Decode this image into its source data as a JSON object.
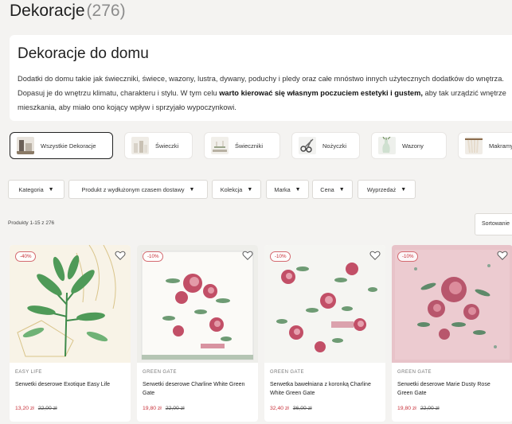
{
  "header": {
    "title": "Dekoracje",
    "count": "(276)"
  },
  "intro": {
    "heading": "Dekoracje do domu",
    "text_before": "Dodatki do domu takie jak świeczniki, świece, wazony, lustra, dywany, poduchy i pledy oraz całe mnóstwo innych użytecznych dodatków do wnętrza. Dopasuj je do wnętrzu klimatu, charakteru i stylu. W tym celu ",
    "text_bold": "warto kierować się własnym poczuciem estetyki i gustem,",
    "text_after": " aby tak urządzić wnętrze mieszkania, aby miało ono kojący wpływ i sprzyjało wypoczynkowi."
  },
  "categories": [
    {
      "label": "Wszystkie Dekoracje",
      "active": true,
      "icon": "decor-thumb"
    },
    {
      "label": "Świeczki",
      "active": false,
      "icon": "candles-thumb"
    },
    {
      "label": "Świeczniki",
      "active": false,
      "icon": "candlesticks-thumb"
    },
    {
      "label": "Nożyczki",
      "active": false,
      "icon": "scissors-thumb"
    },
    {
      "label": "Wazony",
      "active": false,
      "icon": "vase-thumb"
    },
    {
      "label": "Makramy",
      "active": false,
      "icon": "macrame-thumb"
    }
  ],
  "filters": [
    {
      "label": "Kategoria"
    },
    {
      "label": "Produkt z wydłużonym czasem dostawy"
    },
    {
      "label": "Kolekcja"
    },
    {
      "label": "Marka"
    },
    {
      "label": "Cena"
    },
    {
      "label": "Wyprzedaż"
    }
  ],
  "listing": {
    "count_label": "Produkty 1-15 z 276",
    "sort_label": "Sortowanie"
  },
  "products": [
    {
      "badge": "-40%",
      "brand": "EASY LIFE",
      "name": "Serwetki deserowe Exotique Easy Life",
      "price": "13,20 zł",
      "old_price": "22,00 zł"
    },
    {
      "badge": "-10%",
      "brand": "GREEN GATE",
      "name": "Serwetki deserowe Charline White Green Gate",
      "price": "19,80 zł",
      "old_price": "22,00 zł"
    },
    {
      "badge": "-10%",
      "brand": "GREEN GATE",
      "name": "Serwetka bawełniana z koronką Charline White Green Gate",
      "price": "32,40 zł",
      "old_price": "36,00 zł"
    },
    {
      "badge": "-10%",
      "brand": "GREEN GATE",
      "name": "Serwetki deserowe Marie Dusty Rose Green Gate",
      "price": "19,80 zł",
      "old_price": "22,00 zł"
    }
  ],
  "colors": {
    "accent": "#c8313a",
    "page_bg": "#f4f3f1"
  }
}
